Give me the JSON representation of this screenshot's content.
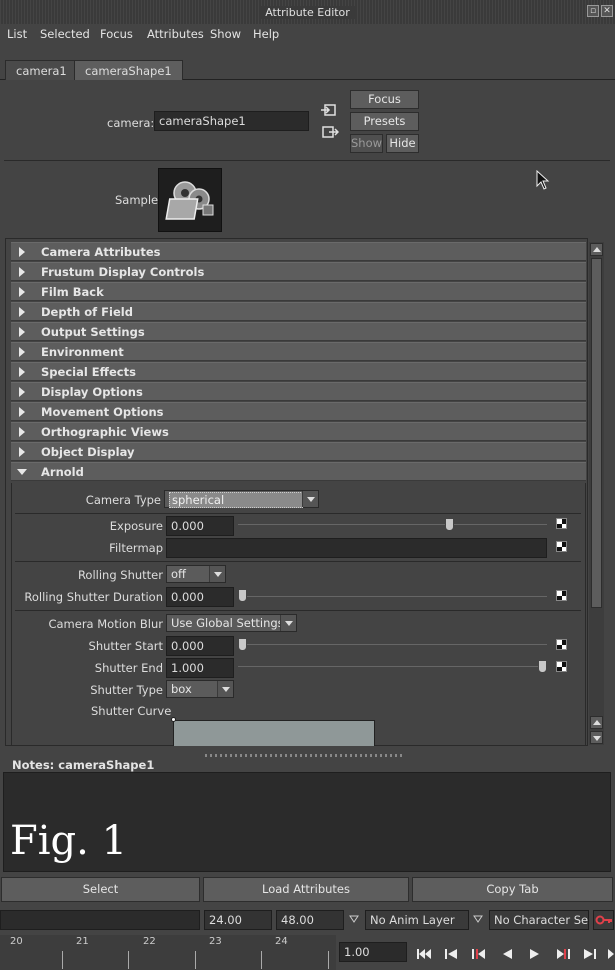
{
  "window": {
    "title": "Attribute Editor"
  },
  "menu": [
    "List",
    "Selected",
    "Focus",
    "Attributes",
    "Show",
    "Help"
  ],
  "tabs": [
    {
      "label": "camera1"
    },
    {
      "label": "cameraShape1",
      "active": true
    }
  ],
  "header": {
    "node_label": "camera:",
    "node_value": "cameraShape1",
    "focus_label": "Focus",
    "presets_label": "Presets",
    "show_label": "Show",
    "hide_label": "Hide",
    "sample_label": "Sample"
  },
  "sections": [
    {
      "title": "Camera Attributes",
      "expanded": false
    },
    {
      "title": "Frustum Display Controls",
      "expanded": false
    },
    {
      "title": "Film Back",
      "expanded": false
    },
    {
      "title": "Depth of Field",
      "expanded": false
    },
    {
      "title": "Output Settings",
      "expanded": false
    },
    {
      "title": "Environment",
      "expanded": false
    },
    {
      "title": "Special Effects",
      "expanded": false
    },
    {
      "title": "Display Options",
      "expanded": false
    },
    {
      "title": "Movement Options",
      "expanded": false
    },
    {
      "title": "Orthographic Views",
      "expanded": false
    },
    {
      "title": "Object Display",
      "expanded": false
    },
    {
      "title": "Arnold",
      "expanded": true
    }
  ],
  "arnold": {
    "camera_type_label": "Camera Type",
    "camera_type_value": "spherical",
    "exposure_label": "Exposure",
    "exposure_value": "0.000",
    "exposure_slider": 0.69,
    "filtermap_label": "Filtermap",
    "filtermap_value": "",
    "rolling_shutter_label": "Rolling Shutter",
    "rolling_shutter_value": "off",
    "rolling_duration_label": "Rolling Shutter Duration",
    "rolling_duration_value": "0.000",
    "rolling_duration_slider": 0.0,
    "motion_blur_label": "Camera Motion Blur",
    "motion_blur_value": "Use Global Settings",
    "shutter_start_label": "Shutter Start",
    "shutter_start_value": "0.000",
    "shutter_start_slider": 0.0,
    "shutter_end_label": "Shutter End",
    "shutter_end_value": "1.000",
    "shutter_end_slider": 1.0,
    "shutter_type_label": "Shutter Type",
    "shutter_type_value": "box",
    "shutter_curve_label": "Shutter Curve"
  },
  "notes": {
    "label": "Notes:  cameraShape1",
    "overlay": "Fig. 1"
  },
  "actions": {
    "select": "Select",
    "load": "Load Attributes",
    "copy": "Copy Tab"
  },
  "range": {
    "start": "24.00",
    "end": "48.00",
    "anim_layer": "No Anim Layer",
    "char_set": "No Character Set"
  },
  "time": {
    "ticks": [
      "20",
      "21",
      "22",
      "23",
      "24"
    ],
    "current": "1.00"
  },
  "colors": {
    "panel": "#444444",
    "field": "#2b2b2b",
    "section": "#5d5d5d",
    "key_icon": "#c0392b"
  }
}
